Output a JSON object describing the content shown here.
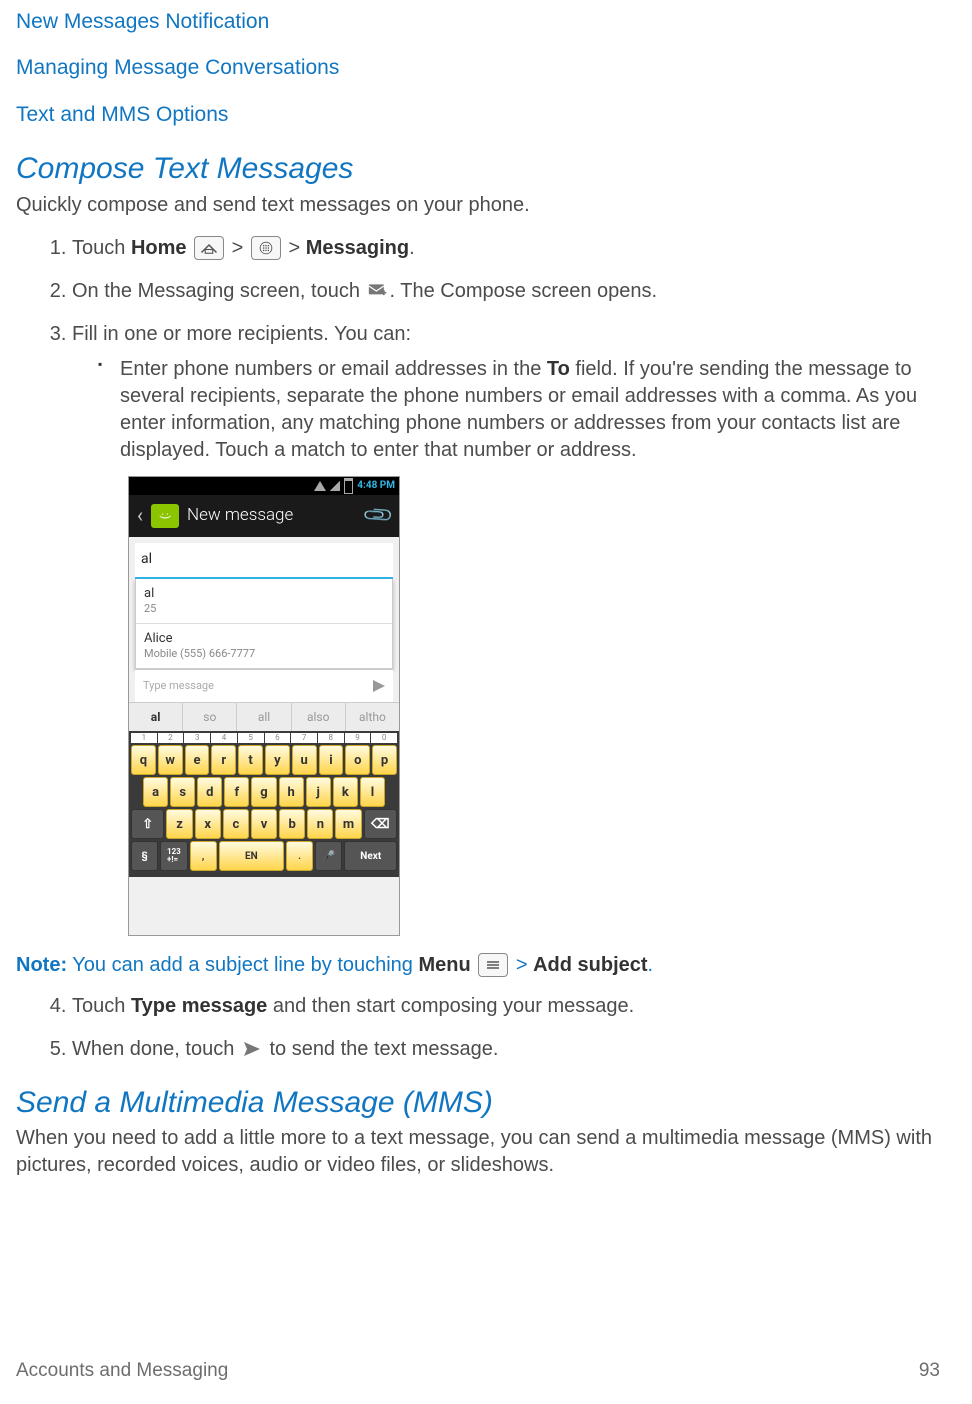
{
  "nav_links": {
    "new_messages": "New Messages Notification",
    "managing": "Managing Message Conversations",
    "options": "Text and MMS Options"
  },
  "section1": {
    "heading": "Compose Text Messages",
    "intro": "Quickly compose and send text messages on your phone.",
    "step1_a": "Touch ",
    "step1_home": "Home",
    "step1_b": " > ",
    "step1_c": " > ",
    "step1_messaging": "Messaging",
    "step1_d": ".",
    "step2_a": "On the Messaging screen, touch ",
    "step2_b": ". The Compose screen opens.",
    "step3": "Fill in one or more recipients. You can:",
    "bullet_a": "Enter phone numbers or email addresses in the ",
    "bullet_to": "To",
    "bullet_b": " field. If you're sending the message to several recipients, separate the phone numbers or email addresses with a comma. As you enter information, any matching phone numbers or addresses from your contacts list are displayed. Touch a match to enter that number or address.",
    "note_label": "Note:",
    "note_a": "  You can add a subject line by touching ",
    "note_menu": "Menu",
    "note_b": " > ",
    "note_add": "Add subject",
    "note_c": ".",
    "step4_a": "Touch ",
    "step4_type": "Type message",
    "step4_b": " and then start composing your message.",
    "step5_a": "When done, touch ",
    "step5_b": " to send the text message."
  },
  "section2": {
    "heading": "Send a Multimedia Message (MMS)",
    "intro": "When you need to add a little more to a text message, you can send a multimedia message (MMS) with pictures, recorded voices, audio or video files, or slideshows."
  },
  "phone": {
    "clock": "4:48 PM",
    "header_title": "New message",
    "to_value": "al",
    "suggest1_name": "al",
    "suggest1_sub": "25",
    "suggest2_name": "Alice",
    "suggest2_sub": "Mobile    (555) 666-7777",
    "type_placeholder": "Type message",
    "predict": [
      "al",
      "so",
      "all",
      "also",
      "altho"
    ],
    "num_row": [
      "1",
      "2",
      "3",
      "4",
      "5",
      "6",
      "7",
      "8",
      "9",
      "0"
    ],
    "row1": [
      "q",
      "w",
      "e",
      "r",
      "t",
      "y",
      "u",
      "i",
      "o",
      "p"
    ],
    "row2": [
      "a",
      "s",
      "d",
      "f",
      "g",
      "h",
      "j",
      "k",
      "l"
    ],
    "row3": [
      "⇧",
      "z",
      "x",
      "c",
      "v",
      "b",
      "n",
      "m",
      "⌫"
    ],
    "row4_swype": "§",
    "row4_123": "123\n+!=",
    "row4_comma": ",",
    "row4_en": "EN",
    "row4_period": ".",
    "row4_mic": "🎤",
    "row4_next": "Next"
  },
  "footer": {
    "section": "Accounts and Messaging",
    "page": "93"
  }
}
